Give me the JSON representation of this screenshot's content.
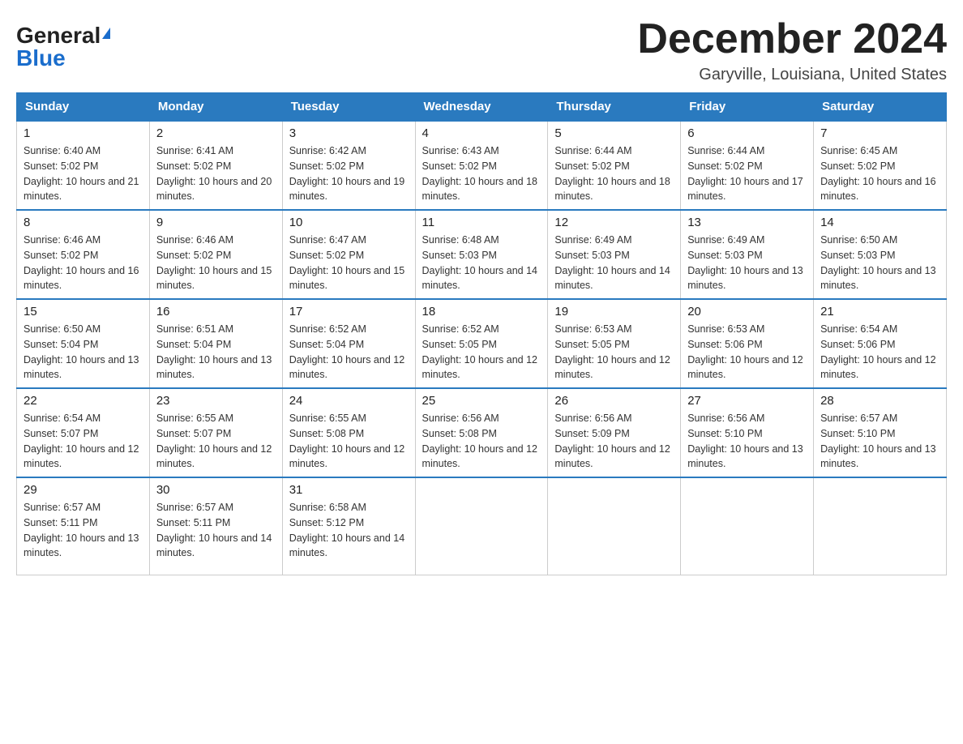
{
  "logo": {
    "general": "General",
    "blue": "Blue"
  },
  "title": "December 2024",
  "location": "Garyville, Louisiana, United States",
  "days_of_week": [
    "Sunday",
    "Monday",
    "Tuesday",
    "Wednesday",
    "Thursday",
    "Friday",
    "Saturday"
  ],
  "weeks": [
    [
      {
        "day": "1",
        "sunrise": "6:40 AM",
        "sunset": "5:02 PM",
        "daylight": "10 hours and 21 minutes."
      },
      {
        "day": "2",
        "sunrise": "6:41 AM",
        "sunset": "5:02 PM",
        "daylight": "10 hours and 20 minutes."
      },
      {
        "day": "3",
        "sunrise": "6:42 AM",
        "sunset": "5:02 PM",
        "daylight": "10 hours and 19 minutes."
      },
      {
        "day": "4",
        "sunrise": "6:43 AM",
        "sunset": "5:02 PM",
        "daylight": "10 hours and 18 minutes."
      },
      {
        "day": "5",
        "sunrise": "6:44 AM",
        "sunset": "5:02 PM",
        "daylight": "10 hours and 18 minutes."
      },
      {
        "day": "6",
        "sunrise": "6:44 AM",
        "sunset": "5:02 PM",
        "daylight": "10 hours and 17 minutes."
      },
      {
        "day": "7",
        "sunrise": "6:45 AM",
        "sunset": "5:02 PM",
        "daylight": "10 hours and 16 minutes."
      }
    ],
    [
      {
        "day": "8",
        "sunrise": "6:46 AM",
        "sunset": "5:02 PM",
        "daylight": "10 hours and 16 minutes."
      },
      {
        "day": "9",
        "sunrise": "6:46 AM",
        "sunset": "5:02 PM",
        "daylight": "10 hours and 15 minutes."
      },
      {
        "day": "10",
        "sunrise": "6:47 AM",
        "sunset": "5:02 PM",
        "daylight": "10 hours and 15 minutes."
      },
      {
        "day": "11",
        "sunrise": "6:48 AM",
        "sunset": "5:03 PM",
        "daylight": "10 hours and 14 minutes."
      },
      {
        "day": "12",
        "sunrise": "6:49 AM",
        "sunset": "5:03 PM",
        "daylight": "10 hours and 14 minutes."
      },
      {
        "day": "13",
        "sunrise": "6:49 AM",
        "sunset": "5:03 PM",
        "daylight": "10 hours and 13 minutes."
      },
      {
        "day": "14",
        "sunrise": "6:50 AM",
        "sunset": "5:03 PM",
        "daylight": "10 hours and 13 minutes."
      }
    ],
    [
      {
        "day": "15",
        "sunrise": "6:50 AM",
        "sunset": "5:04 PM",
        "daylight": "10 hours and 13 minutes."
      },
      {
        "day": "16",
        "sunrise": "6:51 AM",
        "sunset": "5:04 PM",
        "daylight": "10 hours and 13 minutes."
      },
      {
        "day": "17",
        "sunrise": "6:52 AM",
        "sunset": "5:04 PM",
        "daylight": "10 hours and 12 minutes."
      },
      {
        "day": "18",
        "sunrise": "6:52 AM",
        "sunset": "5:05 PM",
        "daylight": "10 hours and 12 minutes."
      },
      {
        "day": "19",
        "sunrise": "6:53 AM",
        "sunset": "5:05 PM",
        "daylight": "10 hours and 12 minutes."
      },
      {
        "day": "20",
        "sunrise": "6:53 AM",
        "sunset": "5:06 PM",
        "daylight": "10 hours and 12 minutes."
      },
      {
        "day": "21",
        "sunrise": "6:54 AM",
        "sunset": "5:06 PM",
        "daylight": "10 hours and 12 minutes."
      }
    ],
    [
      {
        "day": "22",
        "sunrise": "6:54 AM",
        "sunset": "5:07 PM",
        "daylight": "10 hours and 12 minutes."
      },
      {
        "day": "23",
        "sunrise": "6:55 AM",
        "sunset": "5:07 PM",
        "daylight": "10 hours and 12 minutes."
      },
      {
        "day": "24",
        "sunrise": "6:55 AM",
        "sunset": "5:08 PM",
        "daylight": "10 hours and 12 minutes."
      },
      {
        "day": "25",
        "sunrise": "6:56 AM",
        "sunset": "5:08 PM",
        "daylight": "10 hours and 12 minutes."
      },
      {
        "day": "26",
        "sunrise": "6:56 AM",
        "sunset": "5:09 PM",
        "daylight": "10 hours and 12 minutes."
      },
      {
        "day": "27",
        "sunrise": "6:56 AM",
        "sunset": "5:10 PM",
        "daylight": "10 hours and 13 minutes."
      },
      {
        "day": "28",
        "sunrise": "6:57 AM",
        "sunset": "5:10 PM",
        "daylight": "10 hours and 13 minutes."
      }
    ],
    [
      {
        "day": "29",
        "sunrise": "6:57 AM",
        "sunset": "5:11 PM",
        "daylight": "10 hours and 13 minutes."
      },
      {
        "day": "30",
        "sunrise": "6:57 AM",
        "sunset": "5:11 PM",
        "daylight": "10 hours and 14 minutes."
      },
      {
        "day": "31",
        "sunrise": "6:58 AM",
        "sunset": "5:12 PM",
        "daylight": "10 hours and 14 minutes."
      },
      null,
      null,
      null,
      null
    ]
  ]
}
